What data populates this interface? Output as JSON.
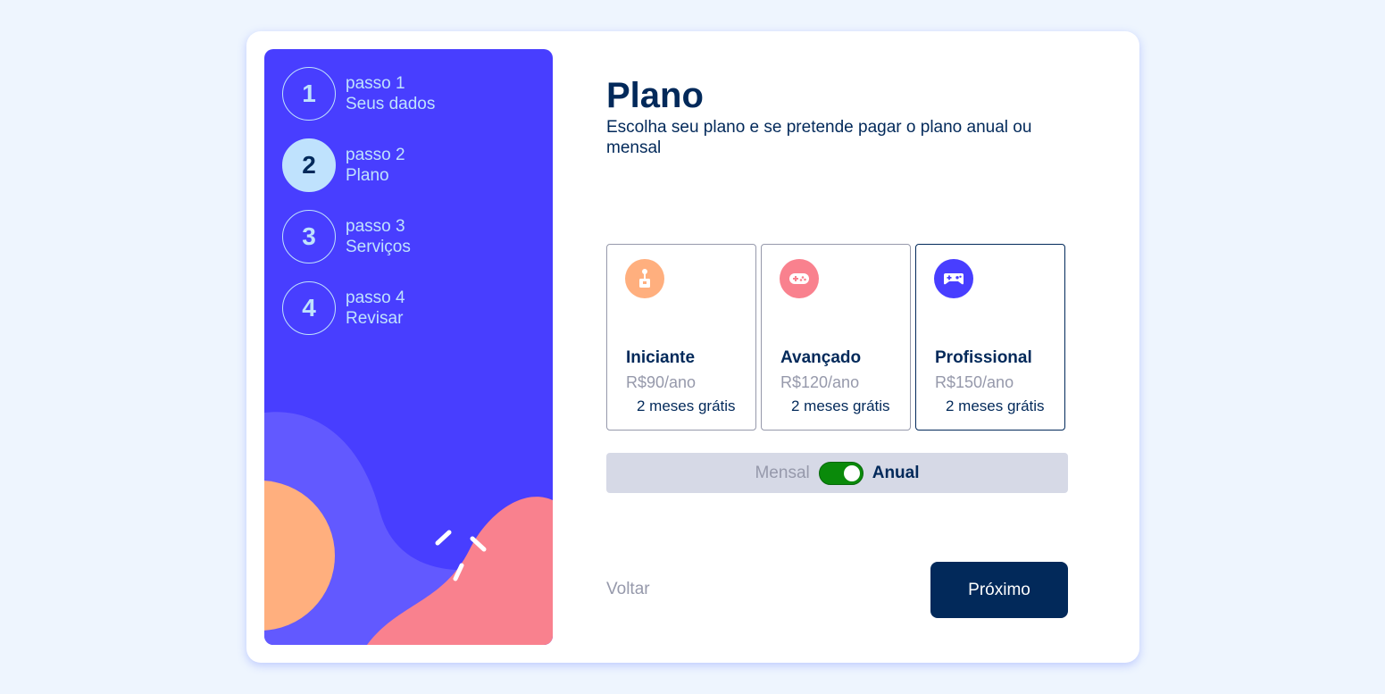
{
  "sidebar": {
    "steps": [
      {
        "number": "1",
        "label": "passo 1",
        "name": "Seus dados",
        "active": false
      },
      {
        "number": "2",
        "label": "passo 2",
        "name": "Plano",
        "active": true
      },
      {
        "number": "3",
        "label": "passo 3",
        "name": "Serviços",
        "active": false
      },
      {
        "number": "4",
        "label": "passo 4",
        "name": "Revisar",
        "active": false
      }
    ]
  },
  "main": {
    "title": "Plano",
    "subtitle": "Escolha seu plano e se pretende pagar o plano anual ou mensal",
    "plans": [
      {
        "name": "Iniciante",
        "price": "R$90/ano",
        "bonus": "2 meses grátis",
        "icon": "arcade-joystick-icon",
        "icon_color": "#ffaf7e",
        "selected": false
      },
      {
        "name": "Avançado",
        "price": "R$120/ano",
        "bonus": "2 meses grátis",
        "icon": "gamepad-icon",
        "icon_color": "#f9818e",
        "selected": false
      },
      {
        "name": "Profissional",
        "price": "R$150/ano",
        "bonus": "2 meses grátis",
        "icon": "game-controller-icon",
        "icon_color": "#483eff",
        "selected": true
      }
    ],
    "billing": {
      "monthly_label": "Mensal",
      "yearly_label": "Anual",
      "yearly_selected": true
    },
    "back_label": "Voltar",
    "next_label": "Próximo"
  },
  "colors": {
    "page_bg": "#eef5fe",
    "sidebar_bg": "#483eff",
    "marine_blue": "#02295a",
    "cool_gray": "#9699ab",
    "light_blue": "#bfe2fd",
    "toggle_on": "#0a8a0a"
  }
}
